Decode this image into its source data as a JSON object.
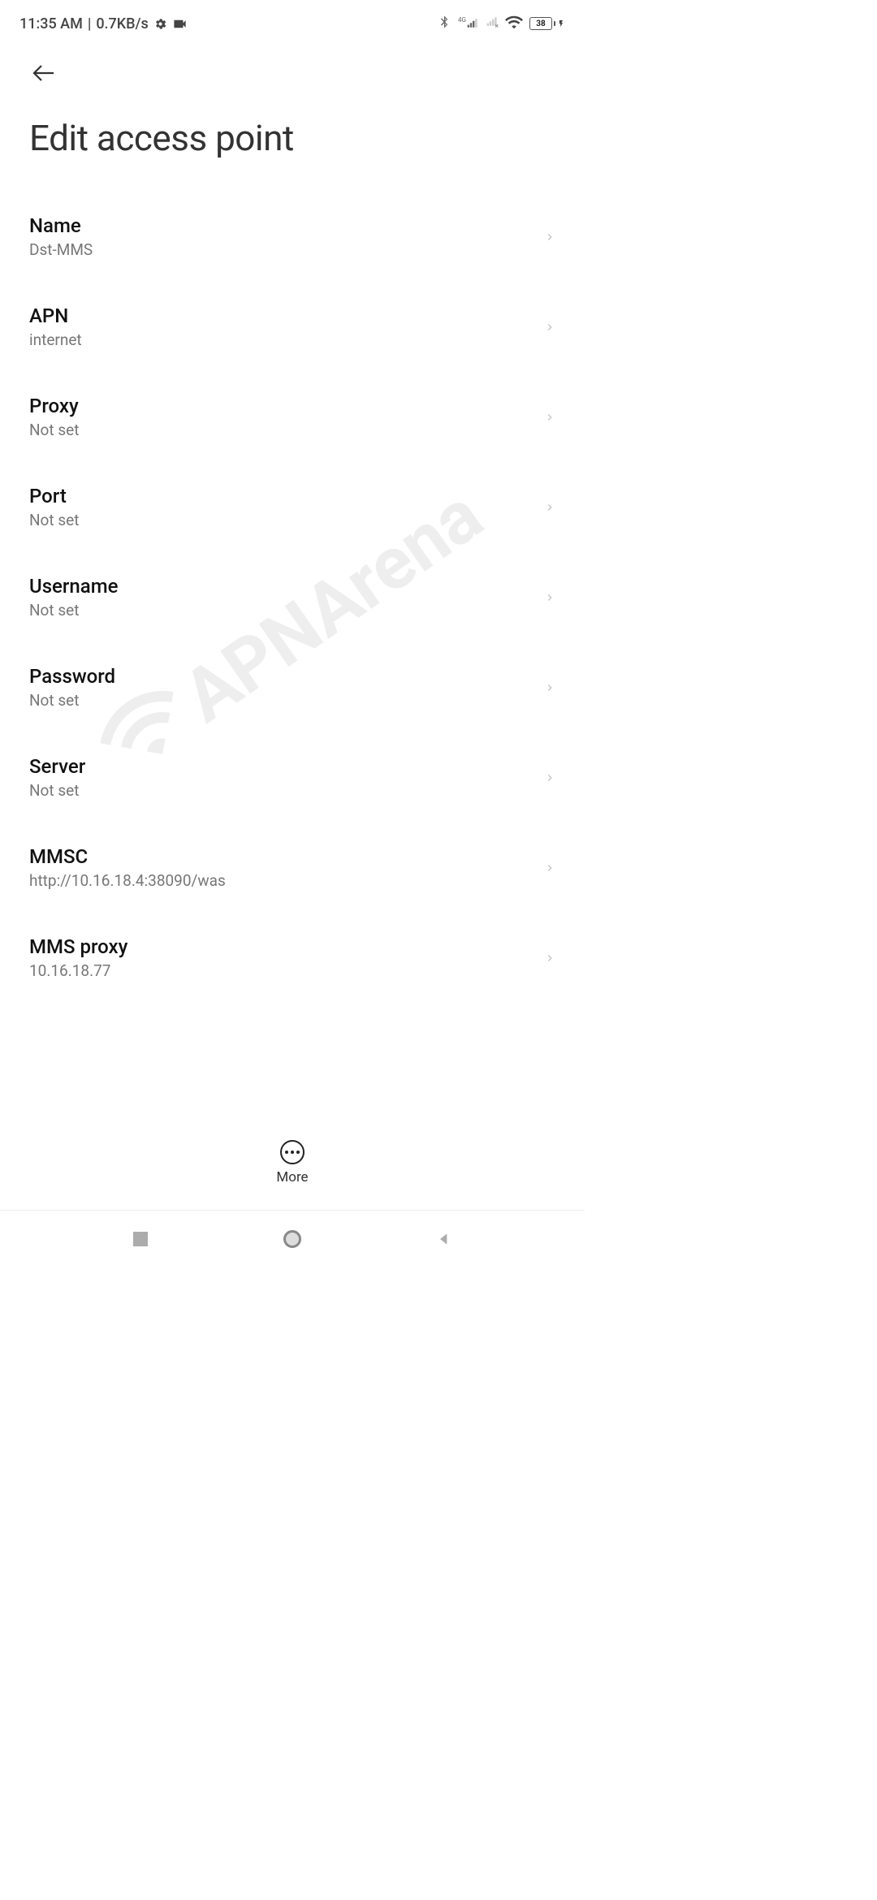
{
  "status_bar": {
    "time": "11:35 AM",
    "speed": "0.7KB/s",
    "network_badge": "4G",
    "battery_percent": "38"
  },
  "header": {
    "title": "Edit access point"
  },
  "settings": [
    {
      "label": "Name",
      "value": "Dst-MMS"
    },
    {
      "label": "APN",
      "value": "internet"
    },
    {
      "label": "Proxy",
      "value": "Not set"
    },
    {
      "label": "Port",
      "value": "Not set"
    },
    {
      "label": "Username",
      "value": "Not set"
    },
    {
      "label": "Password",
      "value": "Not set"
    },
    {
      "label": "Server",
      "value": "Not set"
    },
    {
      "label": "MMSC",
      "value": "http://10.16.18.4:38090/was"
    },
    {
      "label": "MMS proxy",
      "value": "10.16.18.77"
    }
  ],
  "bottom_action": {
    "label": "More"
  },
  "watermark": {
    "text": "APNArena"
  }
}
